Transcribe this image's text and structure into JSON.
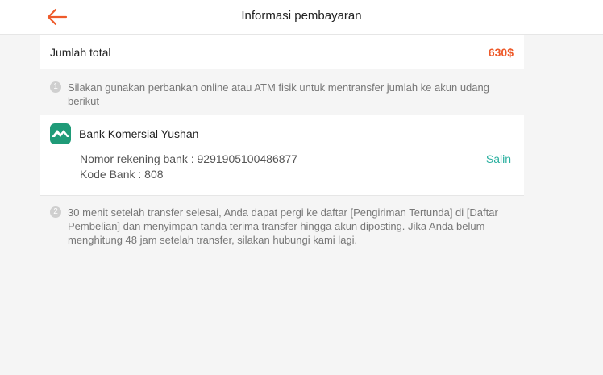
{
  "header": {
    "title": "Informasi pembayaran",
    "back_icon": "arrow-left-icon",
    "back_color": "#ee5a2a"
  },
  "total": {
    "label": "Jumlah total",
    "amount": "630$",
    "amount_color": "#ee5a2a"
  },
  "steps": [
    {
      "number": "1",
      "text": "Silakan gunakan perbankan online atau ATM fisik untuk mentransfer jumlah ke akun udang berikut"
    },
    {
      "number": "2",
      "text": "30 menit setelah transfer selesai, Anda dapat pergi ke daftar [Pengiriman Tertunda] di [Daftar Pembelian] dan menyimpan tanda terima transfer hingga akun diposting. Jika Anda belum menghitung 48 jam setelah transfer, silakan hubungi kami lagi."
    }
  ],
  "bank": {
    "logo_icon": "bank-logo-icon",
    "logo_color": "#1f9b78",
    "name": "Bank Komersial Yushan",
    "account_line": "Nomor rekening bank : 9291905100486877",
    "code_line": "Kode Bank : 808",
    "copy_label": "Salin",
    "copy_color": "#2bb0a0"
  }
}
